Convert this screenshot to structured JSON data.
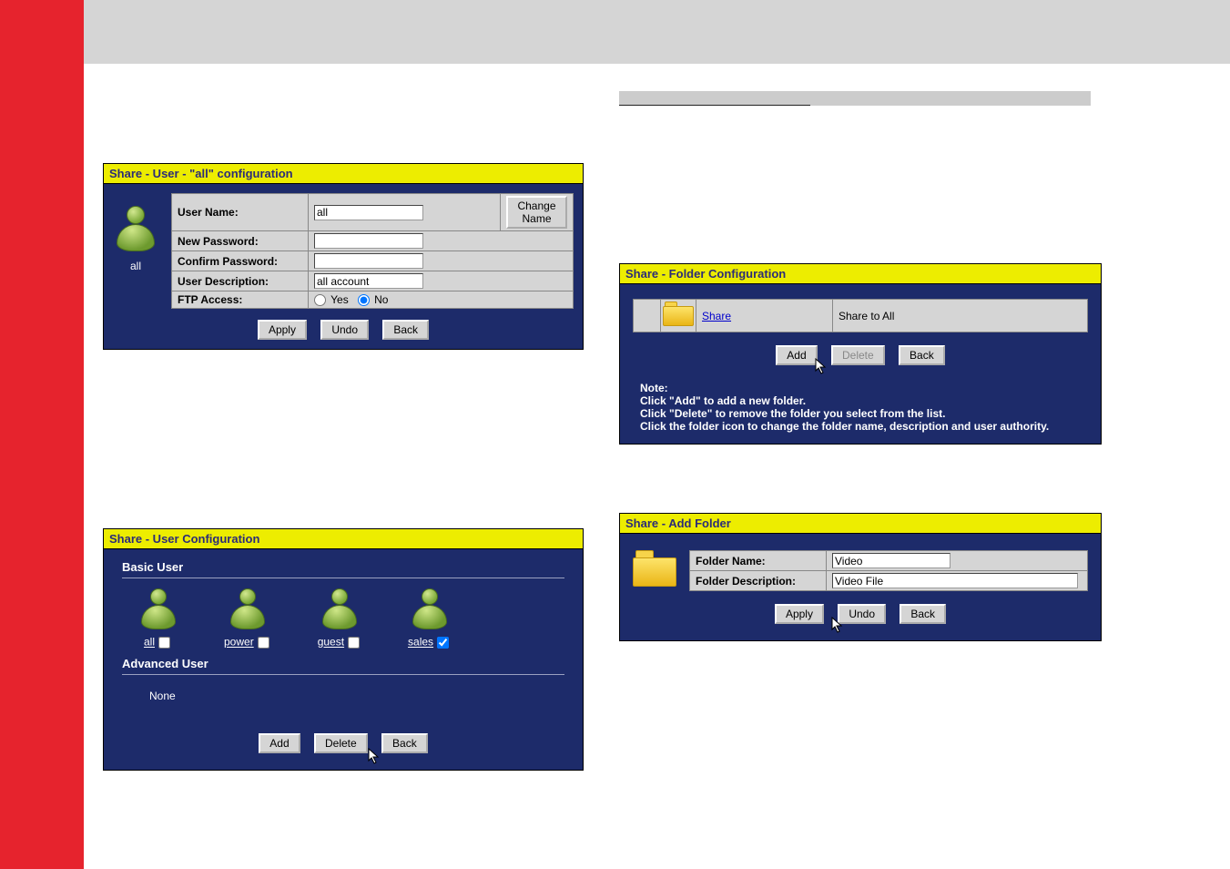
{
  "panel1": {
    "title": "Share - User - \"all\" configuration",
    "fields": {
      "username_label": "User Name:",
      "username_value": "all",
      "newpwd_label": "New Password:",
      "newpwd_value": "",
      "confirmpwd_label": "Confirm Password:",
      "confirmpwd_value": "",
      "desc_label": "User Description:",
      "desc_value": "all account",
      "ftp_label": "FTP Access:",
      "ftp_yes": "Yes",
      "ftp_no": "No"
    },
    "change_name_btn": "Change Name",
    "user_caption": "all",
    "buttons": {
      "apply": "Apply",
      "undo": "Undo",
      "back": "Back"
    }
  },
  "panel2": {
    "title": "Share - User Configuration",
    "basic_heading": "Basic User",
    "advanced_heading": "Advanced User",
    "none_text": "None",
    "users": [
      {
        "name": "all",
        "checked": false
      },
      {
        "name": "power",
        "checked": false
      },
      {
        "name": "guest",
        "checked": false
      },
      {
        "name": "sales",
        "checked": true
      }
    ],
    "buttons": {
      "add": "Add",
      "delete": "Delete",
      "back": "Back"
    }
  },
  "panel3": {
    "title": "Share - Folder Configuration",
    "row": {
      "link": "Share",
      "desc": "Share to All"
    },
    "buttons": {
      "add": "Add",
      "delete": "Delete",
      "back": "Back"
    },
    "note_label": "Note:",
    "note_line1": "Click \"Add\" to add a new folder.",
    "note_line2": "Click \"Delete\" to remove the folder you select from the list.",
    "note_line3": "Click the folder icon to change the folder name, description and user authority."
  },
  "panel4": {
    "title": "Share - Add Folder",
    "fields": {
      "name_label": "Folder Name:",
      "name_value": "Video",
      "desc_label": "Folder Description:",
      "desc_value": "Video File"
    },
    "buttons": {
      "apply": "Apply",
      "undo": "Undo",
      "back": "Back"
    }
  }
}
